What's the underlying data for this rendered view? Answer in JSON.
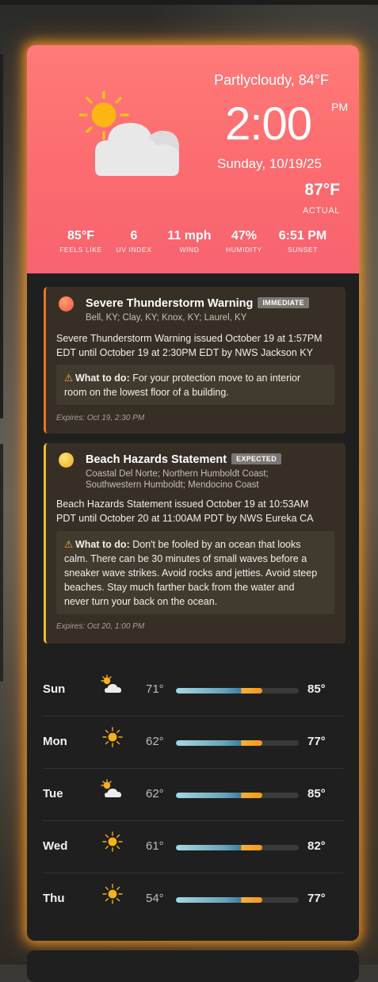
{
  "hero": {
    "condition": "Partlycloudy, 84°F",
    "time": "2:00",
    "ampm": "PM",
    "date": "Sunday, 10/19/25",
    "actual_temp": "87°F",
    "actual_label": "ACTUAL",
    "icon": "partly-cloudy-icon",
    "stats": [
      {
        "value": "85°F",
        "label": "FEELS LIKE"
      },
      {
        "value": "6",
        "label": "UV INDEX"
      },
      {
        "value": "11 mph",
        "label": "WIND"
      },
      {
        "value": "47%",
        "label": "HUMIDITY"
      },
      {
        "value": "6:51 PM",
        "label": "SUNSET"
      }
    ]
  },
  "alerts": [
    {
      "title": "Severe Thunderstorm Warning",
      "badge": "IMMEDIATE",
      "areas": "Bell, KY; Clay, KY; Knox, KY; Laurel, KY",
      "body_lines": [
        "Severe Thunderstorm Warning issued October 19 at 1:57PM",
        "EDT until October 19 at 2:30PM EDT by NWS Jackson KY"
      ],
      "todo_label": "What to do:",
      "todo_lines": [
        "For your protection move to an interior",
        "room on the lowest floor of a building."
      ],
      "expires": "Expires: Oct 19, 2:30 PM",
      "color": "#e8732a"
    },
    {
      "title": "Beach Hazards Statement",
      "badge": "EXPECTED",
      "areas_lines": [
        "Coastal Del Norte; Northern Humboldt Coast;",
        "Southwestern Humboldt; Mendocino Coast"
      ],
      "body_lines": [
        "Beach Hazards Statement issued October 19 at 10:53AM",
        "PDT until October 20 at 11:00AM PDT by NWS Eureka CA"
      ],
      "todo_label": "What to do:",
      "todo_lines": [
        "Don't be fooled by an ocean that looks",
        "calm. There can be 30 minutes of small waves before a",
        "sneaker wave strikes. Avoid rocks and jetties. Avoid steep",
        "beaches. Stay much farther back from the water and",
        "never turn your back on the ocean."
      ],
      "expires": "Expires: Oct 20, 1:00 PM",
      "color": "#e8c12a"
    }
  ],
  "forecast": [
    {
      "day": "Sun",
      "icon": "partly-cloudy-icon",
      "low": "71°",
      "high": "85°",
      "bar_start": 0.0,
      "bar_end": 0.7
    },
    {
      "day": "Mon",
      "icon": "sun-icon",
      "low": "62°",
      "high": "77°",
      "bar_start": 0.0,
      "bar_end": 0.7
    },
    {
      "day": "Tue",
      "icon": "partly-cloudy-icon",
      "low": "62°",
      "high": "85°",
      "bar_start": 0.0,
      "bar_end": 0.7
    },
    {
      "day": "Wed",
      "icon": "sun-icon",
      "low": "61°",
      "high": "82°",
      "bar_start": 0.0,
      "bar_end": 0.7
    },
    {
      "day": "Thu",
      "icon": "sun-icon",
      "low": "54°",
      "high": "77°",
      "bar_start": 0.0,
      "bar_end": 0.7
    }
  ]
}
